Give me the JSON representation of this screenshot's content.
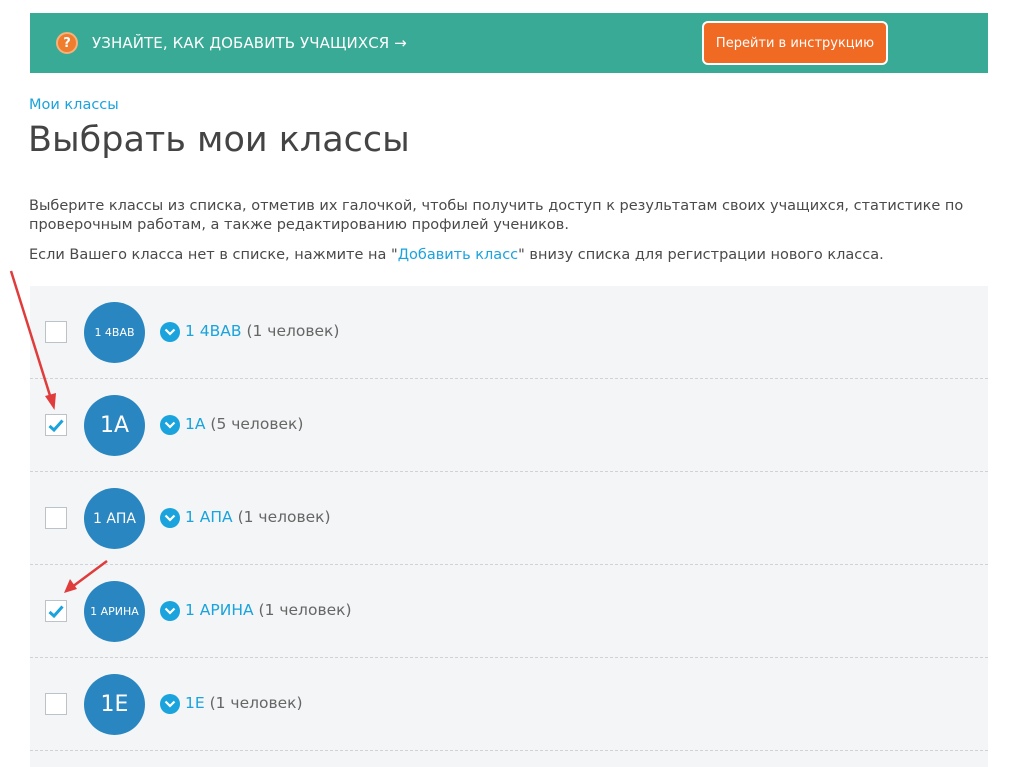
{
  "banner": {
    "help_icon": "?",
    "text": "УЗНАЙТЕ, КАК ДОБАВИТЬ УЧАЩИХСЯ →",
    "button_label": "Перейти в инструкцию",
    "color": "#38aa95",
    "button_color": "#f06a23"
  },
  "breadcrumb": "Мои классы",
  "page_title": "Выбрать мои классы",
  "description": {
    "p1": "Выберите классы из списка, отметив их галочкой, чтобы получить доступ к результатам своих учащихся, статистике по проверочным работам, а также редактированию профилей учеников.",
    "p2_before": "Если Вашего класса нет в списке, нажмите на \"",
    "p2_link": "Добавить класс",
    "p2_after": "\" внизу списка для регистрации нового класса."
  },
  "classes": [
    {
      "avatar": "1 4ВАВ",
      "name": "1 4ВАВ",
      "count": " (1 человек)",
      "checked": false
    },
    {
      "avatar": "1А",
      "name": "1А",
      "count": " (5 человек)",
      "checked": true
    },
    {
      "avatar": "1 АПА",
      "name": "1 АПА",
      "count": " (1 человек)",
      "checked": false
    },
    {
      "avatar": "1 АРИНА",
      "name": "1 АРИНА",
      "count": " (1 человек)",
      "checked": true
    },
    {
      "avatar": "1Е",
      "name": "1Е",
      "count": " (1 человек)",
      "checked": false
    }
  ],
  "colors": {
    "avatar": "#2a86c0",
    "link": "#1aa3dc",
    "annotation_arrow": "#e03c3c"
  },
  "icons": {
    "help": "question-circle-icon",
    "expand": "chevron-down-circle-icon",
    "check": "checkmark-icon",
    "annotation": "red-arrow-annotation"
  }
}
